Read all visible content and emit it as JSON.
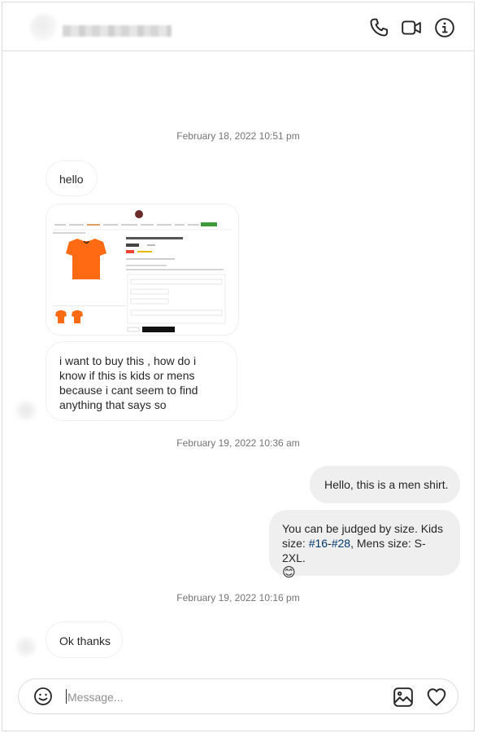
{
  "conversation": {
    "messages": [
      {
        "type": "timestamp",
        "text": "February 18, 2022 10:51 pm"
      },
      {
        "type": "incoming",
        "text": "hello"
      },
      {
        "type": "incoming-image",
        "title": "NETHERLANDS HOME FOOTBALL SHIRT 2022",
        "price": "$50.00",
        "button": "Add to Cart"
      },
      {
        "type": "incoming",
        "lines": [
          "i want to buy this , how do i",
          "know if this is kids or mens",
          "because i cant seem to find",
          "anything that says so"
        ]
      },
      {
        "type": "timestamp",
        "text": "February 19, 2022 10:36 am"
      },
      {
        "type": "outgoing",
        "text": "Hello, this is a men shirt."
      },
      {
        "type": "outgoing",
        "line1": "You can be judged by size. Kids",
        "line2_prefix": "size: ",
        "tag1": "#16",
        "dash": "-",
        "tag2": "#28",
        "line2_suffix": ", Mens size: S-2XL.",
        "emoji": "😊"
      },
      {
        "type": "timestamp",
        "text": "February 19, 2022 10:16 pm"
      },
      {
        "type": "incoming",
        "text": "Ok thanks"
      }
    ]
  },
  "composer": {
    "placeholder": "Message..."
  },
  "icons": {
    "call": "phone-icon",
    "video": "video-camera-icon",
    "info": "info-icon",
    "emoji": "smiley-icon",
    "image": "image-icon",
    "like": "heart-icon"
  },
  "colors": {
    "accent_orange": "#ff6a13",
    "hashtag": "#00376b",
    "outgoing_bubble": "#efefef"
  }
}
